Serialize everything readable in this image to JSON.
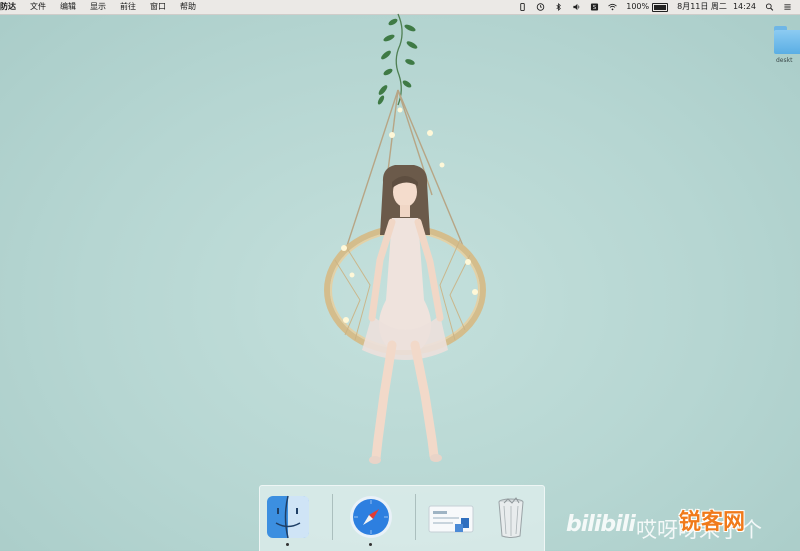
{
  "menubar": {
    "app_menu": "防达",
    "items": [
      "文件",
      "编辑",
      "显示",
      "前往",
      "窗口",
      "帮助"
    ],
    "status": {
      "battery_percent": "100%",
      "date": "8月11日 周二",
      "time": "14:24"
    },
    "icons": [
      "phone-icon",
      "clock-icon",
      "bluetooth-icon",
      "volume-icon",
      "input-method-icon",
      "wifi-icon",
      "battery-icon",
      "search-icon",
      "list-icon"
    ]
  },
  "desktop": {
    "folder_label": "deskt"
  },
  "dock": {
    "items": [
      {
        "name": "Finder",
        "icon": "finder-icon",
        "running": true
      },
      {
        "name": "Safari",
        "icon": "safari-icon",
        "running": true
      },
      {
        "name": "Downloads",
        "icon": "downloads-stack-icon",
        "running": false
      },
      {
        "name": "Trash",
        "icon": "trash-icon",
        "running": false
      }
    ]
  },
  "watermarks": {
    "bilibili": "bilibili",
    "caption": "哎呀呀来了个",
    "site": "锐客网"
  },
  "colors": {
    "desktop_bg": "#b6d6d2",
    "menubar_bg": "#ebe9e6",
    "site_logo": "#f07a1a"
  }
}
